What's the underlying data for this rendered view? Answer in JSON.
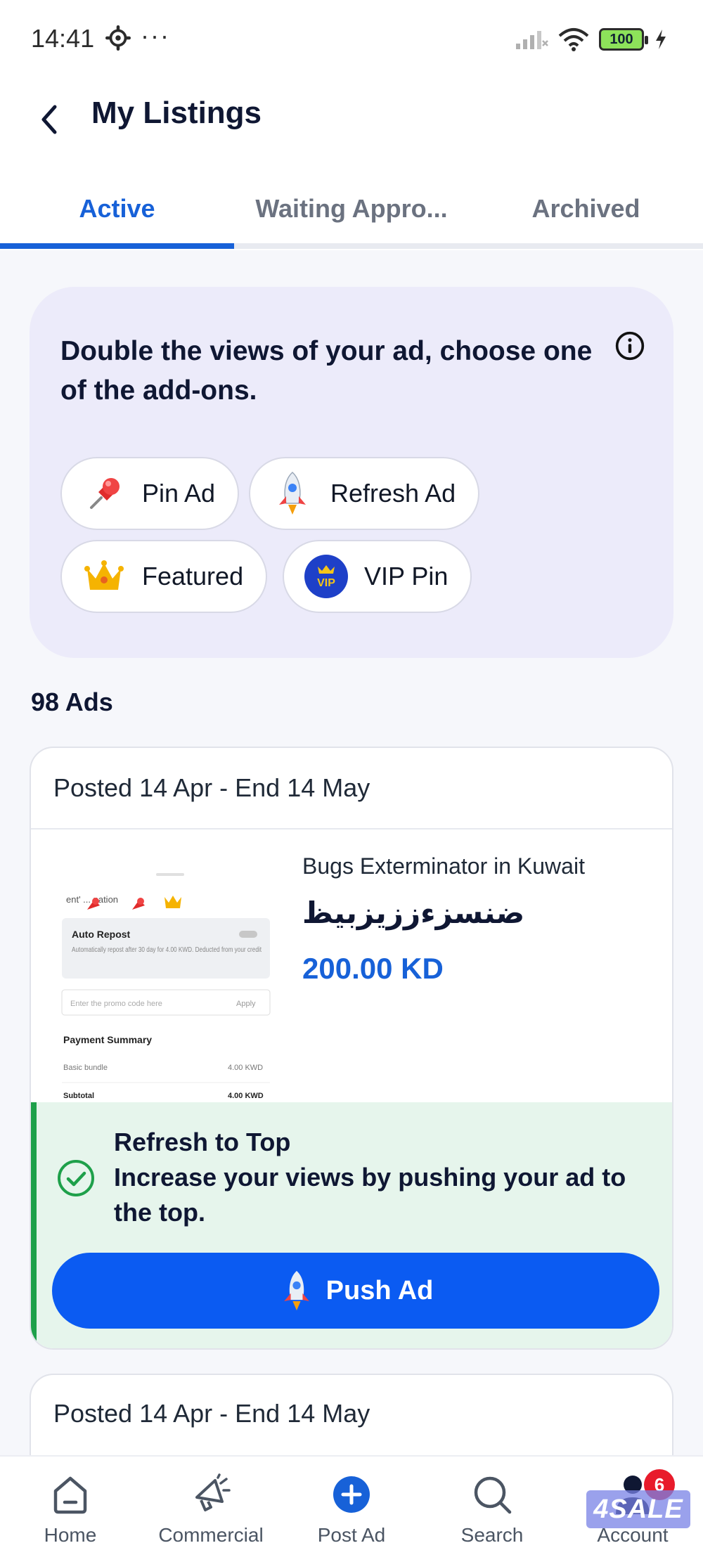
{
  "status_bar": {
    "time": "14:41",
    "dots": "···",
    "battery": "100"
  },
  "header": {
    "title": "My Listings"
  },
  "tabs": [
    {
      "label": "Active"
    },
    {
      "label": "Waiting Appro..."
    },
    {
      "label": "Archived"
    }
  ],
  "promo": {
    "headline": "Double the views of your ad, choose one of the add-ons.",
    "chips": [
      {
        "label": "Pin Ad",
        "icon": "pin-icon"
      },
      {
        "label": "Refresh Ad",
        "icon": "rocket-icon"
      },
      {
        "label": "Featured",
        "icon": "crown-icon"
      },
      {
        "label": "VIP Pin",
        "icon": "vip-icon",
        "icon_text": "VIP"
      }
    ]
  },
  "ads_count": "98 Ads",
  "listings": [
    {
      "posted": "Posted 14 Apr - End 14 May",
      "title": "Bugs Exterminator in Kuwait",
      "subtitle": "ضنسزءززيزبيظ",
      "price": "200.00 KD",
      "thumb": {
        "heading": "ent' ... nation",
        "auto_repost_title": "Auto Repost",
        "auto_repost_desc": "Automatically repost after 30 day for 4.00 KWD. Deducted from your credit",
        "promo_placeholder": "Enter the promo code here",
        "apply": "Apply",
        "summary_title": "Payment Summary",
        "basic_bundle": "Basic bundle",
        "basic_bundle_value": "4.00 KWD",
        "subtotal": "Subtotal",
        "subtotal_value": "4.00 KWD"
      },
      "refresh": {
        "title": "Refresh to Top",
        "description": "Increase your views by pushing your ad to the top.",
        "button": "Push Ad"
      }
    },
    {
      "posted": "Posted 14 Apr - End 14 May"
    }
  ],
  "bottom_nav": [
    {
      "label": "Home",
      "icon": "home-icon"
    },
    {
      "label": "Commercial",
      "icon": "megaphone-icon"
    },
    {
      "label": "Post Ad",
      "icon": "plus-circle-icon"
    },
    {
      "label": "Search",
      "icon": "search-icon"
    },
    {
      "label": "Account",
      "icon": "account-icon",
      "badge": "6"
    }
  ],
  "brand": {
    "logo_text": "4SALE"
  },
  "colors": {
    "accent": "#1761d8",
    "primary_button": "#0b5bf2",
    "success": "#1ea04a",
    "badge": "#e81b2b",
    "promo_bg": "#ecebfa"
  }
}
